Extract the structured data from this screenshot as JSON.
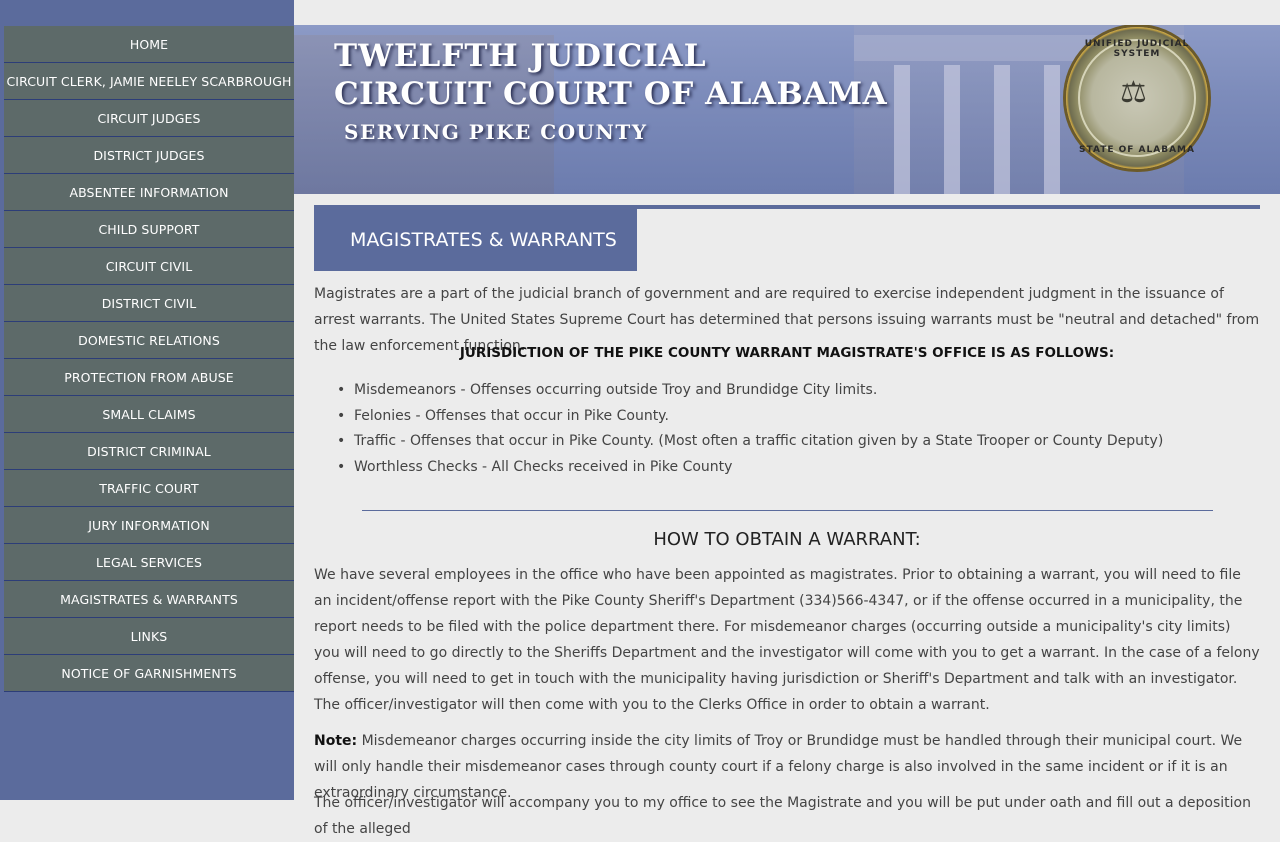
{
  "nav": {
    "items": [
      {
        "label": "HOME"
      },
      {
        "label": "CIRCUIT CLERK, JAMIE NEELEY SCARBROUGH"
      },
      {
        "label": "CIRCUIT JUDGES"
      },
      {
        "label": "DISTRICT JUDGES"
      },
      {
        "label": "ABSENTEE INFORMATION"
      },
      {
        "label": "CHILD SUPPORT"
      },
      {
        "label": "CIRCUIT CIVIL"
      },
      {
        "label": "DISTRICT CIVIL"
      },
      {
        "label": "DOMESTIC RELATIONS"
      },
      {
        "label": "PROTECTION FROM ABUSE"
      },
      {
        "label": "SMALL CLAIMS"
      },
      {
        "label": "DISTRICT CRIMINAL"
      },
      {
        "label": "TRAFFIC COURT"
      },
      {
        "label": "JURY INFORMATION"
      },
      {
        "label": "LEGAL SERVICES"
      },
      {
        "label": "MAGISTRATES & WARRANTS"
      },
      {
        "label": "LINKS"
      },
      {
        "label": "NOTICE OF GARNISHMENTS"
      }
    ]
  },
  "banner": {
    "line1": "TWELFTH  JUDICIAL",
    "line2": "CIRCUIT COURT OF ALABAMA",
    "line3": "SERVING  PIKE COUNTY",
    "seal_top": "UNIFIED JUDICIAL SYSTEM",
    "seal_bottom": "STATE OF ALABAMA"
  },
  "page": {
    "title": "MAGISTRATES & WARRANTS",
    "intro": "Magistrates are a part of the judicial branch of government and are required to exercise independent judgment in the issuance of arrest warrants. The United States Supreme Court has determined that persons issuing warrants must be \"neutral and detached\" from the law enforcement function.",
    "jurisdiction_heading": "JURISDICTION OF THE PIKE COUNTY WARRANT MAGISTRATE'S OFFICE IS AS FOLLOWS:",
    "jurisdiction_items": [
      "Misdemeanors - Offenses occurring outside Troy and Brundidge City limits.",
      "Felonies - Offenses that occur in Pike County.",
      "Traffic - Offenses that occur in Pike County. (Most often a traffic citation given by a State Trooper or County Deputy)",
      "Worthless Checks - All Checks received in Pike County"
    ],
    "how_heading": "HOW TO OBTAIN A WARRANT:",
    "how_text": "We have several employees in the office who have been appointed as magistrates. Prior to obtaining a warrant, you will need to file an incident/offense report with the Pike County Sheriff's Department (334)566-4347, or if the offense occurred in a municipality, the report needs to be filed with the police department there. For misdemeanor charges (occurring outside a municipality's city limits) you will need to go directly to the Sheriffs Department and the investigator will come with you to get a warrant. In the case of a felony offense, you will need to get in touch with the municipality having jurisdiction or Sheriff's Department and talk with an investigator. The officer/investigator will then come with you to the Clerks Office in order to obtain a warrant.",
    "note_label": "Note:",
    "note_text": " Misdemeanor charges occurring inside the city limits of Troy or Brundidge must be handled through their municipal court. We will only handle their misdemeanor cases through county court if a felony charge is also involved in the same incident or if it is an extraordinary circumstance.",
    "cut_text": "The officer/investigator will accompany you to my office to see the Magistrate and you will be put under oath and fill out a deposition of the alleged"
  },
  "colors": {
    "accent": "#5b6b9c",
    "nav_bg": "#5d6a69",
    "page_bg": "#ececec"
  }
}
